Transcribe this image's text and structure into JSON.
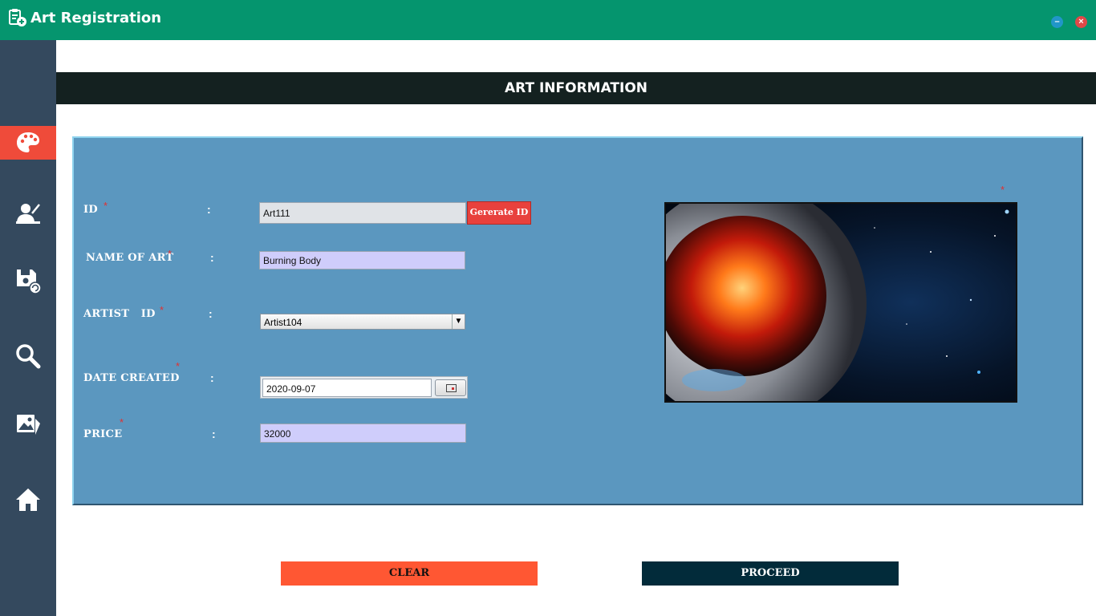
{
  "window": {
    "title": "Art Registration",
    "minimize_label": "–",
    "close_label": "×"
  },
  "sidebar": {
    "items": [
      {
        "name": "palette",
        "active": true
      },
      {
        "name": "artist"
      },
      {
        "name": "save"
      },
      {
        "name": "search"
      },
      {
        "name": "gallery"
      },
      {
        "name": "home"
      }
    ]
  },
  "header": {
    "title": "ART INFORMATION"
  },
  "form": {
    "id": {
      "label": "ID",
      "value": "Art111",
      "button": "Gererate ID"
    },
    "name": {
      "label": "NAME OF ART",
      "value": "Burning Body"
    },
    "artist": {
      "label": "ARTIST   ID",
      "value": "Artist104"
    },
    "date": {
      "label": "DATE CREATED",
      "value": "2020-09-07"
    },
    "price": {
      "label": "PRICE",
      "value": "32000"
    },
    "required_mark": "*",
    "colon": ":"
  },
  "actions": {
    "clear": "CLEAR",
    "proceed": "PROCEED"
  },
  "colors": {
    "titlebar": "#05956e",
    "sidebar": "#34495e",
    "active": "#ef4b3a",
    "panel": "#5b97bf",
    "header": "#142120",
    "clear": "#ff5733",
    "proceed": "#022b3a"
  }
}
